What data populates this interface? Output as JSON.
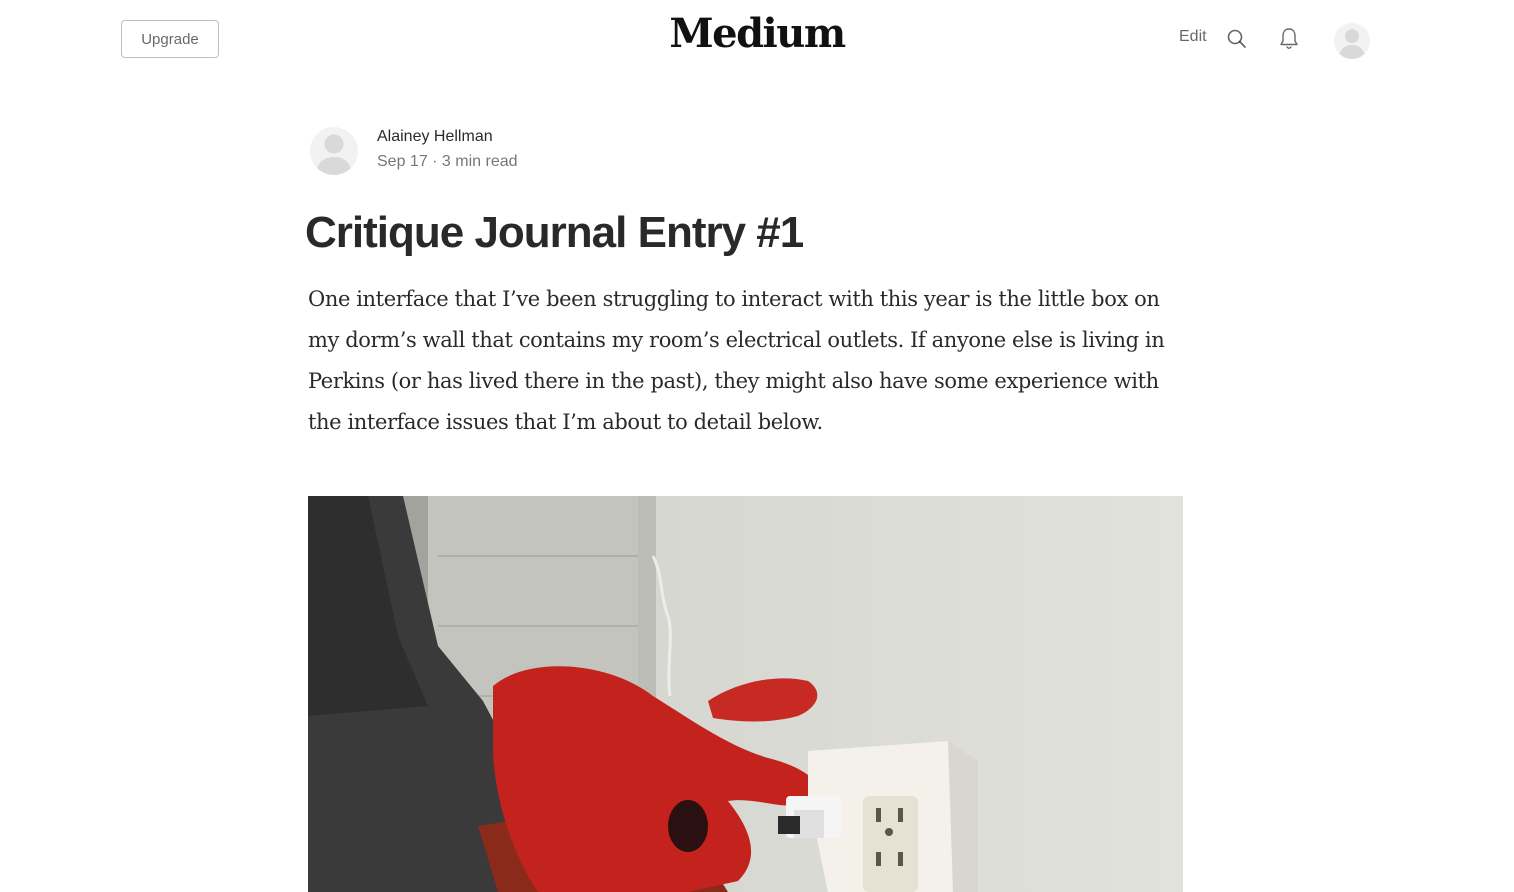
{
  "header": {
    "upgrade_label": "Upgrade",
    "logo": "Medium",
    "edit_label": "Edit",
    "icons": [
      "search-icon",
      "bell-icon",
      "avatar-placeholder-icon"
    ]
  },
  "article": {
    "author": "Alainey Hellman",
    "meta": "Sep 17 · 3 min read",
    "title": "Critique Journal Entry #1",
    "body": "One interface that I’ve been struggling to interact with this year is the little box on my dorm’s wall that contains my room’s electrical outlets. If anyone else is living in Perkins (or has lived there in the past), they might also have some experience with the interface issues that I’m about to detail below."
  },
  "colors": {
    "text": "#292929",
    "muted": "#757575",
    "avatar_bg": "#f2f2f2",
    "avatar_fg": "#d9d9d9"
  }
}
